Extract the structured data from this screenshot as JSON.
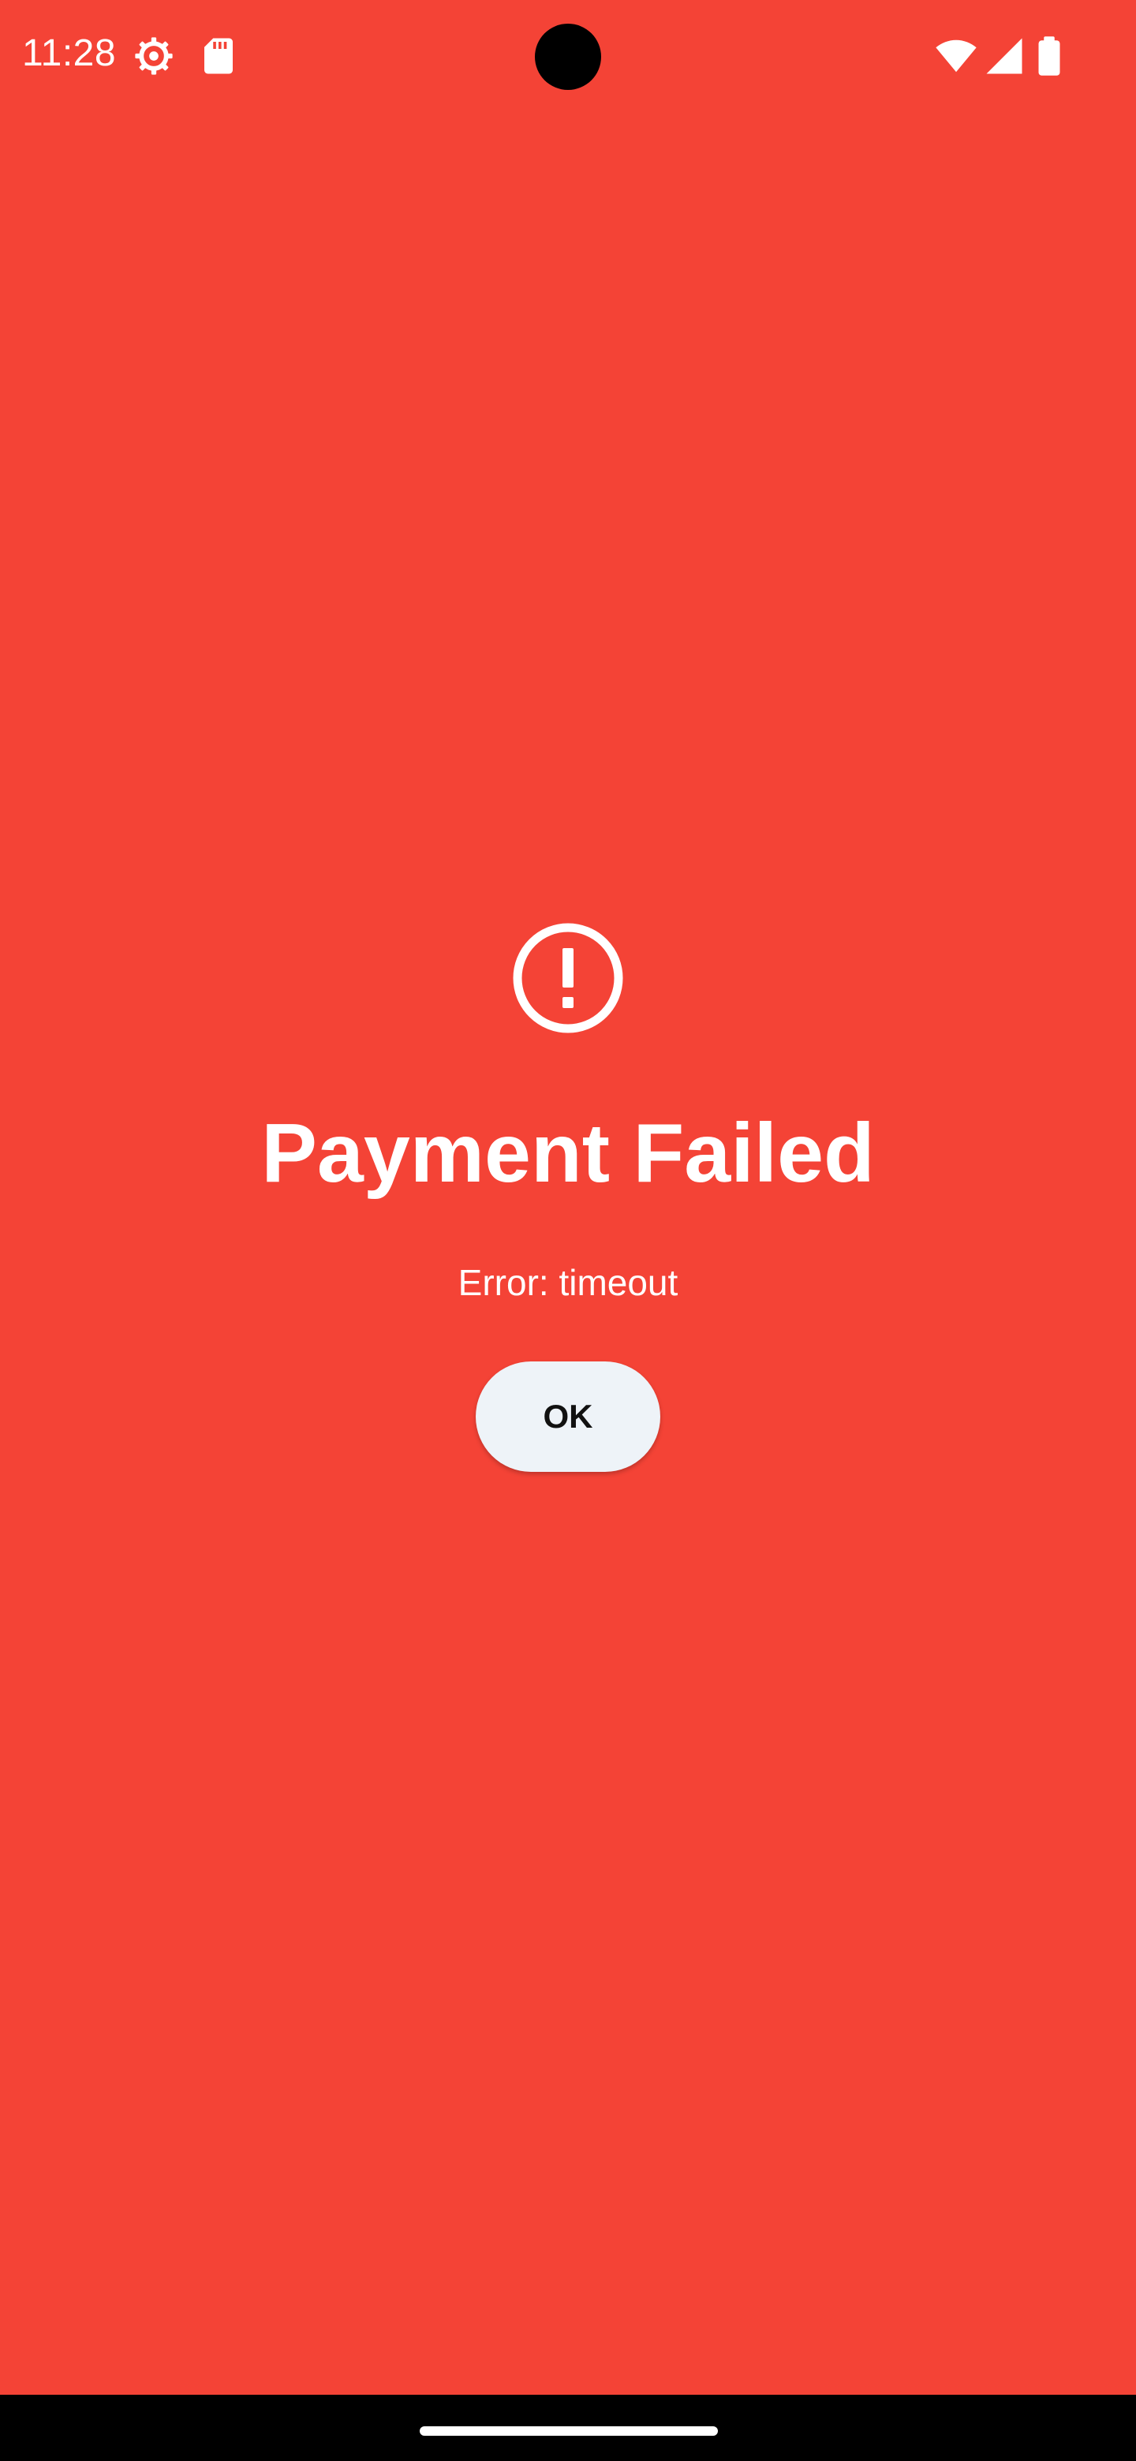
{
  "status_bar": {
    "time": "11:28",
    "icons": [
      "settings-gear-icon",
      "sd-card-icon",
      "wifi-icon",
      "cellular-signal-icon",
      "battery-icon"
    ]
  },
  "alert": {
    "icon": "exclamation-circle-icon",
    "title": "Payment Failed",
    "message": "Error: timeout",
    "button_label": "OK"
  },
  "colors": {
    "background": "#F44336",
    "text": "#FFFFFF",
    "button_background": "#EEF3F8",
    "button_text": "#111111"
  }
}
